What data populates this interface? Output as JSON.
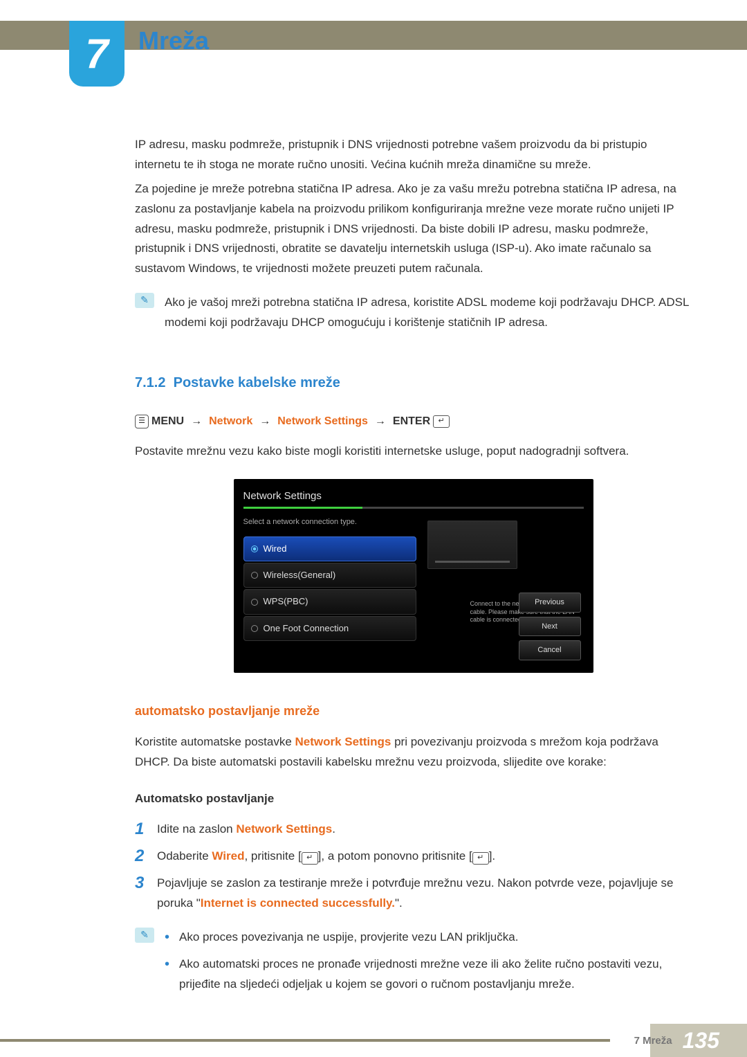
{
  "chapter": {
    "number": "7",
    "title": "Mreža"
  },
  "intro": {
    "p1": "IP adresu, masku podmreže, pristupnik i DNS vrijednosti potrebne vašem proizvodu da bi pristupio internetu te ih stoga ne morate ručno unositi. Većina kućnih mreža dinamične su mreže.",
    "p2": "Za pojedine je mreže potrebna statična IP adresa. Ako je za vašu mrežu potrebna statična IP adresa, na zaslonu za postavljanje kabela na proizvodu prilikom konfiguriranja mrežne veze morate ručno unijeti IP adresu, masku podmreže, pristupnik i DNS vrijednosti. Da biste dobili IP adresu, masku podmreže, pristupnik i DNS vrijednosti, obratite se davatelju internetskih usluga (ISP-u). Ako imate računalo sa sustavom Windows, te vrijednosti možete preuzeti putem računala.",
    "note": "Ako je vašoj mreži potrebna statična IP adresa, koristite ADSL modeme koji podržavaju DHCP. ADSL modemi koji podržavaju DHCP omogućuju i korištenje statičnih IP adresa."
  },
  "section": {
    "number": "7.1.2",
    "title": "Postavke kabelske mreže",
    "menu_path": {
      "menu": "MENU",
      "p1": "Network",
      "p2": "Network Settings",
      "enter": "ENTER"
    },
    "desc": "Postavite mrežnu vezu kako biste mogli koristiti internetske usluge, poput nadogradnji softvera."
  },
  "screenshot": {
    "title": "Network Settings",
    "subtitle": "Select a network connection type.",
    "options": [
      "Wired",
      "Wireless(General)",
      "WPS(PBC)",
      "One Foot Connection"
    ],
    "help": "Connect to the network using LAN cable. Please make sure that the LAN cable is connected.",
    "buttons": [
      "Previous",
      "Next",
      "Cancel"
    ]
  },
  "auto": {
    "title": "automatsko postavljanje mreže",
    "desc_a": "Koristite automatske postavke ",
    "desc_hl": "Network Settings",
    "desc_b": " pri povezivanju proizvoda s mrežom koja podržava DHCP. Da biste automatski postavili kabelsku mrežnu vezu proizvoda, slijedite ove korake:",
    "sub": "Automatsko postavljanje",
    "steps": {
      "s1_a": "Idite na zaslon ",
      "s1_hl": "Network Settings",
      "s1_b": ".",
      "s2_a": "Odaberite ",
      "s2_hl": "Wired",
      "s2_b": ", pritisnite [",
      "s2_c": "], a potom ponovno pritisnite [",
      "s2_d": "].",
      "s3_a": "Pojavljuje se zaslon za testiranje mreže i potvrđuje mrežnu vezu. Nakon potvrde veze, pojavljuje se poruka \"",
      "s3_hl": "Internet is connected successfully.",
      "s3_b": "\"."
    },
    "bullets": {
      "b1": "Ako proces povezivanja ne uspije, provjerite vezu LAN priključka.",
      "b2": "Ako automatski proces ne pronađe vrijednosti mrežne veze ili ako želite ručno postaviti vezu, prijeđite na sljedeći odjeljak u kojem se govori o ručnom postavljanju mreže."
    }
  },
  "footer": {
    "label": "7 Mreža",
    "page": "135"
  }
}
